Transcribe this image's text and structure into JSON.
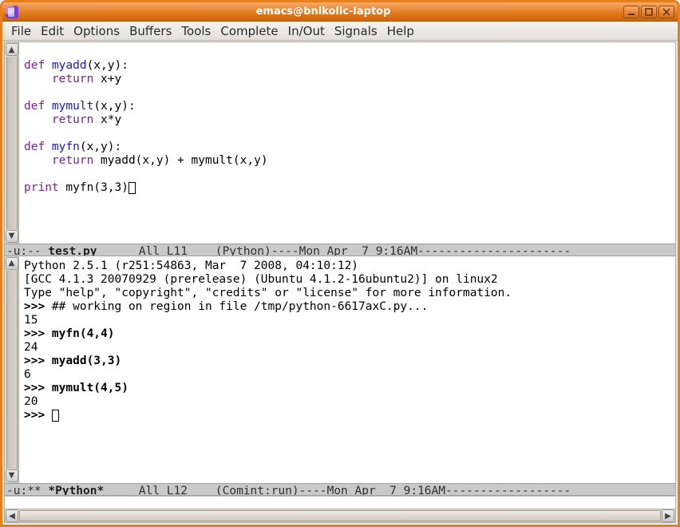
{
  "window": {
    "title": "emacs@bnikolic-laptop"
  },
  "menu": {
    "file": "File",
    "edit": "Edit",
    "options": "Options",
    "buffers": "Buffers",
    "tools": "Tools",
    "complete": "Complete",
    "inout": "In/Out",
    "signals": "Signals",
    "help": "Help"
  },
  "editor": {
    "line1a": "def ",
    "line1b": "myadd",
    "line1c": "(x,y):",
    "line2a": "    return ",
    "line2b": "x+y",
    "line4a": "def ",
    "line4b": "mymult",
    "line4c": "(x,y):",
    "line5a": "    return ",
    "line5b": "x*y",
    "line7a": "def ",
    "line7b": "myfn",
    "line7c": "(x,y):",
    "line8a": "    return ",
    "line8b": "myadd(x,y) + mymult(x,y)",
    "line10a": "print ",
    "line10b": "myfn(3,3)"
  },
  "modeline1": {
    "prefix": "-u:-- ",
    "buffer": "test.py",
    "rest": "      All L11    (Python)----Mon Apr  7 9:16AM----------------------"
  },
  "repl": {
    "l1": "Python 2.5.1 (r251:54863, Mar  7 2008, 04:10:12)",
    "l2": "[GCC 4.1.3 20070929 (prerelease) (Ubuntu 4.1.2-16ubuntu2)] on linux2",
    "l3": "Type \"help\", \"copyright\", \"credits\" or \"license\" for more information.",
    "p1": ">>> ",
    "w1": "## working on region in file /tmp/python-6617axC.py...",
    "o1": "15",
    "p2": ">>> ",
    "c2": "myfn(4,4)",
    "o2": "24",
    "p3": ">>> ",
    "c3": "myadd(3,3)",
    "o3": "6",
    "p4": ">>> ",
    "c4": "mymult(4,5)",
    "o4": "20",
    "p5": ">>> "
  },
  "modeline2": {
    "prefix": "-u:** ",
    "buffer": "*Python*",
    "rest": "     All L12    (Comint:run)----Mon Apr  7 9:16AM------------------"
  }
}
